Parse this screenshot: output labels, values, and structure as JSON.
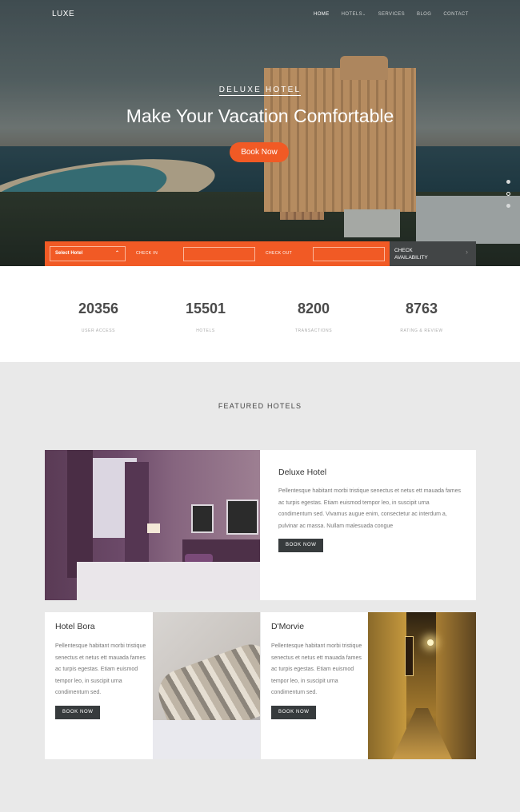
{
  "nav": {
    "logo": "LUXE",
    "items": [
      "HOME",
      "HOTELS",
      "SERVICES",
      "BLOG",
      "CONTACT"
    ]
  },
  "hero": {
    "subtitle": "DELUXE HOTEL",
    "title": "Make Your Vacation Comfortable",
    "button": "Book Now"
  },
  "booking": {
    "select_hotel": "Select Hotel",
    "check_in": "CHECK IN",
    "check_out": "CHECK OUT",
    "check_availability": "CHECK AVAILABILITY"
  },
  "stats": [
    {
      "value": "20356",
      "label": "USER ACCESS"
    },
    {
      "value": "15501",
      "label": "HOTELS"
    },
    {
      "value": "8200",
      "label": "TRANSACTIONS"
    },
    {
      "value": "8763",
      "label": "RATING & REVIEW"
    }
  ],
  "featured": {
    "title": "FEATURED HOTELS",
    "cards": [
      {
        "name": "Deluxe Hotel",
        "text": "Pellentesque habitant morbi tristique senectus et netus ett mauada fames ac turpis egestas. Etiam euismod tempor leo, in suscipit urna condimentum sed. Vivamus augue enim, consectetur ac interdum a, pulvinar ac massa. Nullam malesuada congue",
        "button": "BOOK NOW"
      },
      {
        "name": "Hotel Bora",
        "text": "Pellentesque habitant morbi tristique senectus et netus ett mauada fames ac turpis egestas. Etiam euismod tempor leo, in suscipit urna condimentum sed.",
        "button": "BOOK NOW"
      },
      {
        "name": "D'Morvie",
        "text": "Pellentesque habitant morbi tristique senectus et netus ett mauada fames ac turpis egestas. Etiam euismod tempor leo, in suscipit urna condimentum sed.",
        "button": "BOOK NOW"
      }
    ]
  },
  "colors": {
    "accent": "#f15a25",
    "dark": "#424546"
  }
}
